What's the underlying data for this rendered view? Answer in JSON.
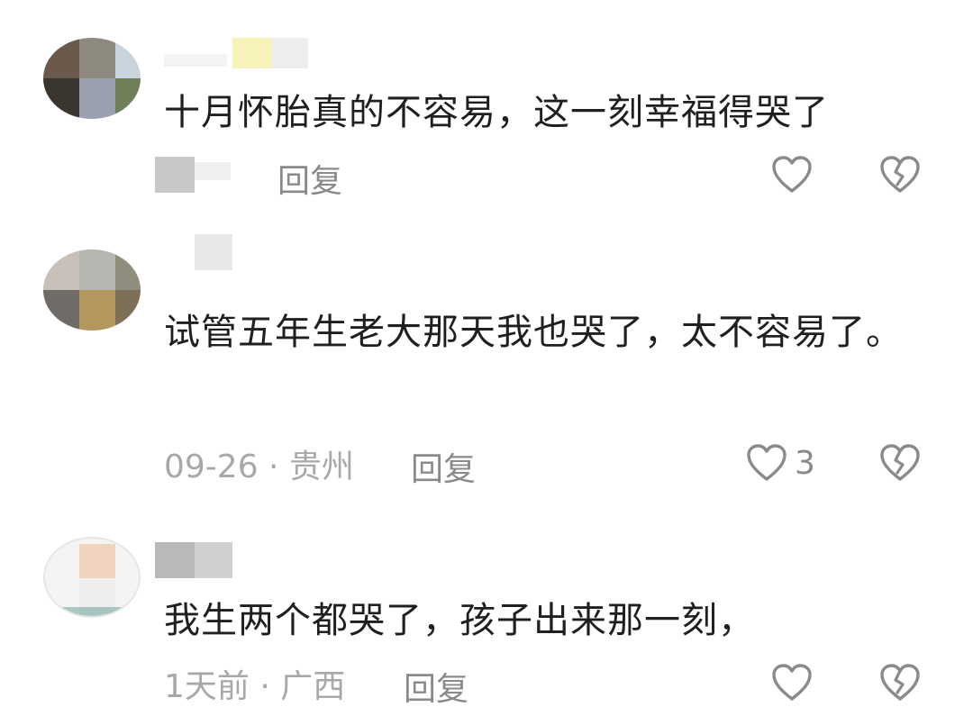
{
  "comments": [
    {
      "text": "十月怀胎真的不容易，这一刻幸福得哭了",
      "meta": "",
      "reply_label": "回复",
      "like_count": "",
      "avatar_colors": [
        "#6b5a4b",
        "#8f8a80",
        "#c9d3dc",
        "#3b3530",
        "#9aa0ad",
        "#6f7f5a"
      ],
      "username_colors": [
        "#f6f2b8",
        "#eeeeee"
      ]
    },
    {
      "text": "试管五年生老大那天我也哭了，太不容易了。",
      "meta": "09-26 · 贵州",
      "reply_label": "回复",
      "like_count": "3",
      "avatar_colors": [
        "#c7c1b9",
        "#8f8d7c",
        "#b3975f",
        "#6f6b66",
        "#7e7058"
      ],
      "username_colors": [
        "#e8e8e8"
      ]
    },
    {
      "text": "我生两个都哭了，孩子出来那一刻，",
      "meta": "1天前 · 广西",
      "reply_label": "回复",
      "like_count": "",
      "avatar_colors": [
        "#f2d3c0",
        "#dedede",
        "#eeeeee",
        "#7aa8a3"
      ],
      "username_colors": [
        "#b9b9b9",
        "#cfcfcf"
      ]
    }
  ],
  "icons": {
    "like": "heart-outline-icon",
    "dislike": "broken-heart-icon"
  },
  "colors": {
    "text": "#1f1f1f",
    "meta": "#a8a8a8",
    "icon": "#8a8a8a"
  }
}
